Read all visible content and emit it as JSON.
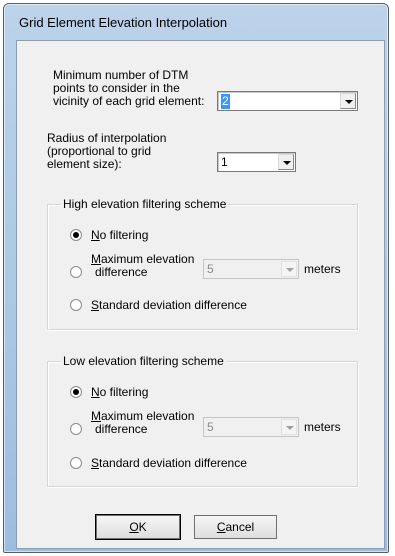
{
  "window": {
    "title": "Grid Element Elevation Interpolation"
  },
  "dtm_points": {
    "label_lines": [
      "Minimum number of DTM",
      "points to consider in the",
      "vicinity of each grid element:"
    ],
    "value": "2"
  },
  "radius": {
    "label_lines": [
      "Radius of interpolation",
      "(proportional to grid",
      "element size):"
    ],
    "value": "1"
  },
  "high_filter": {
    "title": "High elevation filtering scheme",
    "no_filtering": {
      "accel": "N",
      "rest": "o filtering",
      "checked": true
    },
    "max_elevation": {
      "accel": "M",
      "rest_line1": "aximum elevation",
      "line2": "difference",
      "value": "5",
      "unit": "meters"
    },
    "std_dev": {
      "accel": "S",
      "rest": "tandard deviation difference"
    }
  },
  "low_filter": {
    "title": "Low elevation filtering scheme",
    "no_filtering": {
      "accel": "N",
      "rest": "o filtering",
      "checked": true
    },
    "max_elevation": {
      "accel": "M",
      "rest_line1": "aximum elevation",
      "line2": "difference",
      "value": "5",
      "unit": "meters"
    },
    "std_dev": {
      "accel": "S",
      "rest": "tandard deviation difference"
    }
  },
  "buttons": {
    "ok": {
      "accel": "O",
      "rest": "K"
    },
    "cancel": {
      "accel": "C",
      "rest": "ancel"
    }
  }
}
